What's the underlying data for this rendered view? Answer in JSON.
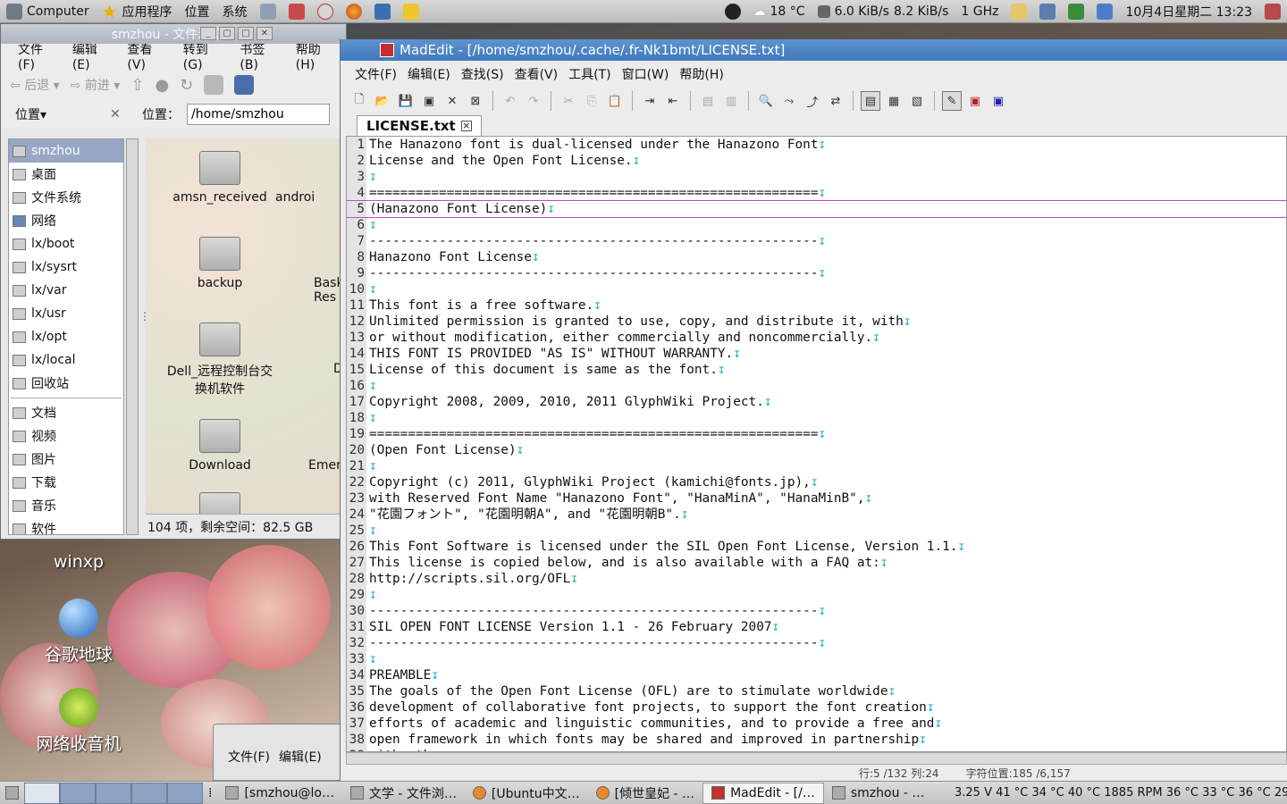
{
  "top_panel": {
    "computer": "Computer",
    "applications": "应用程序",
    "places": "位置",
    "system": "系统",
    "weather": "18 °C",
    "net_down": "6.0 KiB/s",
    "net_up": "8.2 KiB/s",
    "cpu_freq": "1 GHz",
    "clock": "10月4日星期二 13:23"
  },
  "desktop": {
    "icons": [
      "winxp",
      "谷歌地球",
      "网络收音机"
    ]
  },
  "file_manager": {
    "title": "smzhou - 文件浏览器",
    "menu": [
      "文件(F)",
      "编辑(E)",
      "查看(V)",
      "转到(G)",
      "书签(B)",
      "帮助(H)"
    ],
    "back": "后退",
    "forward": "前进",
    "places_label": "位置",
    "location_label": "位置：",
    "location_value": "/home/smzhou",
    "sidebar": [
      "smzhou",
      "桌面",
      "文件系统",
      "网络",
      "lx/boot",
      "lx/sysrt",
      "lx/var",
      "lx/usr",
      "lx/opt",
      "lx/local",
      "回收站"
    ],
    "bookmarks": [
      "文档",
      "视频",
      "图片",
      "下载",
      "音乐",
      "软件"
    ],
    "files": [
      "amsn_received",
      "androi",
      "backup",
      "Baske Res",
      "Dell_远程控制台交换机软件",
      "De",
      "Download",
      "Emera"
    ],
    "status": "104 项，剩余空间：82.5 GB"
  },
  "editor": {
    "title": "MadEdit - [/home/smzhou/.cache/.fr-Nk1bmt/LICENSE.txt]",
    "menu": [
      "文件(F)",
      "编辑(E)",
      "查找(S)",
      "查看(V)",
      "工具(T)",
      "窗口(W)",
      "帮助(H)"
    ],
    "tab": "LICENSE.txt",
    "status_pos": "行:5 /132 列:24",
    "status_char": "字符位置:185 /6,157",
    "lines": [
      "The Hanazono font is dual-licensed under the Hanazono Font",
      "License and the Open Font License.",
      "",
      "==========================================================",
      "(Hanazono Font License)",
      "",
      "----------------------------------------------------------",
      "Hanazono Font License",
      "----------------------------------------------------------",
      "",
      "This font is a free software.",
      "Unlimited permission is granted to use, copy, and distribute it, with",
      "or without modification, either commercially and noncommercially.",
      "THIS FONT IS PROVIDED \"AS IS\" WITHOUT WARRANTY.",
      "License of this document is same as the font.",
      "",
      "Copyright 2008, 2009, 2010, 2011 GlyphWiki Project.",
      "",
      "==========================================================",
      "(Open Font License)",
      "",
      "Copyright (c) 2011, GlyphWiki Project (kamichi@fonts.jp),",
      "with Reserved Font Name \"Hanazono Font\", \"HanaMinA\", \"HanaMinB\",",
      "\"花園フォント\", \"花園明朝A\", and \"花園明朝B\".",
      "",
      "This Font Software is licensed under the SIL Open Font License, Version 1.1.",
      "This license is copied below, and is also available with a FAQ at:",
      "http://scripts.sil.org/OFL",
      "",
      "----------------------------------------------------------",
      "SIL OPEN FONT LICENSE Version 1.1 - 26 February 2007",
      "----------------------------------------------------------",
      "",
      "PREAMBLE",
      "The goals of the Open Font License (OFL) are to stimulate worldwide",
      "development of collaborative font projects, to support the font creation",
      "efforts of academic and linguistic communities, and to provide a free and",
      "open framework in which fonts may be shared and improved in partnership",
      "with others."
    ]
  },
  "bottom_window": {
    "menu": [
      "文件(F)",
      "编辑(E)"
    ]
  },
  "taskbar": {
    "tasks": [
      "[smzhou@lo…",
      "文学 - 文件浏…",
      "[Ubuntu中文…",
      "[倾世皇妃 - …",
      "MadEdit - [/…",
      "smzhou - …"
    ],
    "sensors": "3.25 V 41 °C 34 °C 40 °C 1885 RPM 36 °C 33 °C 36 °C 29 °C"
  }
}
